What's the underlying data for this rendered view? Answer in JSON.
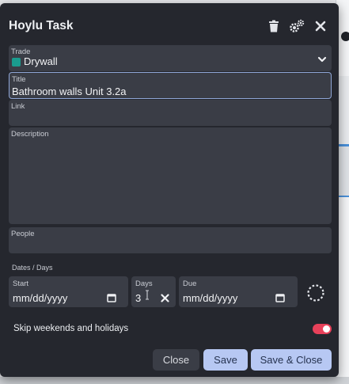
{
  "dialog": {
    "title": "Hoylu Task",
    "icons": [
      "trash-icon",
      "gears-icon",
      "close-icon"
    ]
  },
  "fields": {
    "trade": {
      "label": "Trade",
      "value": "Drywall",
      "swatch_color": "#1a9c8f"
    },
    "title": {
      "label": "Title",
      "value": "Bathroom walls Unit 3.2a"
    },
    "link": {
      "label": "Link",
      "value": ""
    },
    "description": {
      "label": "Description",
      "value": ""
    },
    "people": {
      "label": "People",
      "value": ""
    }
  },
  "dates": {
    "section_label": "Dates / Days",
    "start": {
      "label": "Start",
      "value": "mm/dd/yyyy"
    },
    "days": {
      "label": "Days",
      "value": "3"
    },
    "due": {
      "label": "Due",
      "value": "mm/dd/yyyy"
    }
  },
  "options": {
    "skip_weekends_label": "Skip weekends and holidays",
    "skip_weekends_on": true,
    "toggle_color": "#e8415a"
  },
  "buttons": {
    "close": "Close",
    "save": "Save",
    "save_close": "Save & Close"
  }
}
